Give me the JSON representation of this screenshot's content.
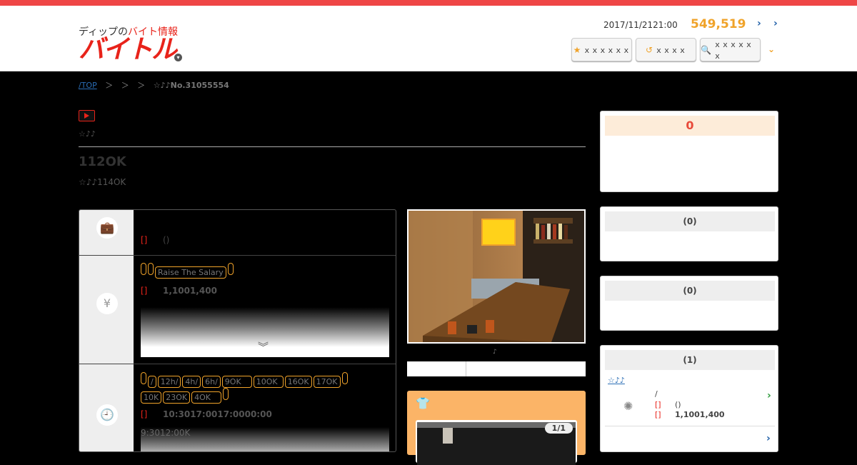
{
  "header": {
    "logo_sub_pre": "ディップの",
    "logo_sub_red": "バイト情報",
    "logo_main": "バイトル",
    "stamp": "2017/11/2121:00",
    "count": "549,519",
    "chev_small": "›",
    "chev_right": "›",
    "buttons": [
      {
        "icon": "★",
        "label": "ｘｘｘｘｘｘ"
      },
      {
        "icon": "↺",
        "label": "ｘｘｘｘ"
      },
      {
        "icon": "🔍",
        "label": "ｘｘｘｘｘｘ"
      }
    ],
    "more_chev": "⌄"
  },
  "breadcrumb": {
    "top": "/TOP",
    "sep1": "＞",
    "sep2": "＞",
    "sep3": "＞",
    "last": "☆♪♪No.31055554"
  },
  "job": {
    "small_title": "☆♪♪",
    "big_title": "112OK",
    "sub_title": "☆♪♪114OK"
  },
  "rows": {
    "r1": {
      "bracket": "[]",
      "text": "()"
    },
    "r2": {
      "tags": [
        "",
        "",
        "Raise The Salary",
        ""
      ],
      "bracket": "[]",
      "text": "1,1001,400",
      "chev": "︾"
    },
    "r3": {
      "tags_line1": [
        "",
        "/",
        "12h/",
        "4h/",
        "6h/",
        "9OK",
        "10OK",
        "16OK",
        "17OK",
        ""
      ],
      "tags_line2": [
        "10K",
        "23OK",
        "4OK",
        ""
      ],
      "bracket": "[]",
      "text": "10:3017:0017:0000:00",
      "faded": "9:3012:00K"
    }
  },
  "photo": {
    "caption": "♪"
  },
  "orange": {
    "pager": "1/1"
  },
  "panels": {
    "p1": {
      "header": "0"
    },
    "p2": {
      "header": "(0)"
    },
    "p3": {
      "header": "(0)"
    },
    "p4": {
      "header": "(1)",
      "link": "☆♪♪",
      "line1": "/",
      "red1": "[]",
      "val1": "()",
      "red2": "[]",
      "val2": "1,1001,400",
      "more": "›"
    }
  },
  "colors": {
    "brand_red": "#e8231a",
    "accent_orange": "#f0a32a",
    "link_blue": "#2a6db5"
  }
}
